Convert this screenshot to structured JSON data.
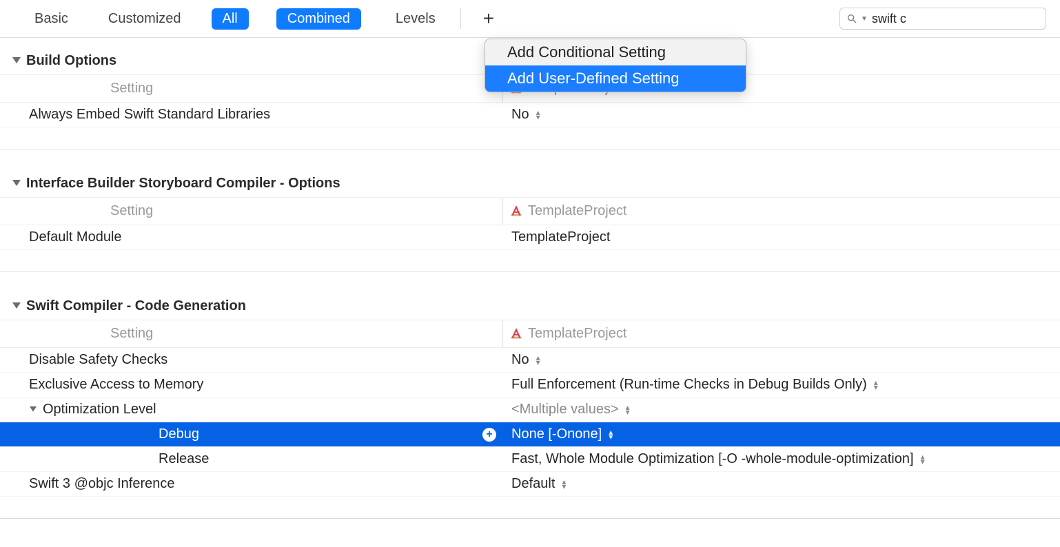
{
  "toolbar": {
    "basic": "Basic",
    "customized": "Customized",
    "all": "All",
    "combined": "Combined",
    "levels": "Levels",
    "plus": "+"
  },
  "search": {
    "value": "swift c"
  },
  "dropdown": {
    "item1": "Add Conditional Setting",
    "item2": "Add User-Defined Setting"
  },
  "sections": {
    "buildOptions": {
      "title": "Build Options",
      "settingLabel": "Setting",
      "project": "TemplateProject",
      "rows": {
        "r1": {
          "label": "Always Embed Swift Standard Libraries",
          "value": "No"
        }
      }
    },
    "ib": {
      "title": "Interface Builder Storyboard Compiler - Options",
      "settingLabel": "Setting",
      "project": "TemplateProject",
      "rows": {
        "r1": {
          "label": "Default Module",
          "value": "TemplateProject"
        }
      }
    },
    "swift": {
      "title": "Swift Compiler - Code Generation",
      "settingLabel": "Setting",
      "project": "TemplateProject",
      "rows": {
        "safety": {
          "label": "Disable Safety Checks",
          "value": "No"
        },
        "exclusive": {
          "label": "Exclusive Access to Memory",
          "value": "Full Enforcement (Run-time Checks in Debug Builds Only)"
        },
        "optLevel": {
          "label": "Optimization Level",
          "value": "<Multiple values>"
        },
        "optDebug": {
          "label": "Debug",
          "value": "None [-Onone]"
        },
        "optRelease": {
          "label": "Release",
          "value": "Fast, Whole Module Optimization  [-O -whole-module-optimization]"
        },
        "objc": {
          "label": "Swift 3 @objc Inference",
          "value": "Default"
        }
      }
    }
  }
}
